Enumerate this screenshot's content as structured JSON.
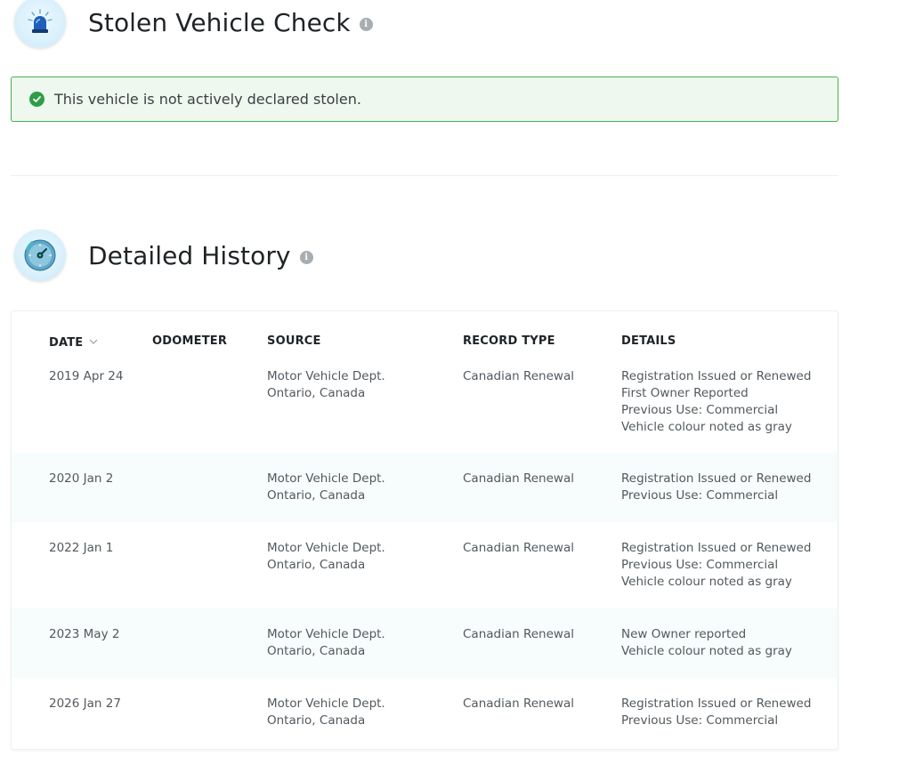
{
  "stolen": {
    "title": "Stolen Vehicle Check",
    "icon": "siren-icon",
    "status_text": "This vehicle is not actively declared stolen.",
    "status_color": "#2e9e46"
  },
  "history": {
    "title": "Detailed History",
    "icon": "odometer-gauge-icon",
    "columns": {
      "date": "DATE",
      "odometer": "ODOMETER",
      "source": "SOURCE",
      "record_type": "RECORD TYPE",
      "details": "DETAILS"
    },
    "rows": [
      {
        "date": "2019 Apr 24",
        "odometer": "",
        "source": [
          "Motor Vehicle Dept.",
          "Ontario, Canada"
        ],
        "record_type": "Canadian Renewal",
        "details": [
          "Registration Issued or Renewed",
          "First Owner Reported",
          "Previous Use: Commercial",
          "Vehicle colour noted as gray"
        ]
      },
      {
        "date": "2020 Jan 2",
        "odometer": "",
        "source": [
          "Motor Vehicle Dept.",
          "Ontario, Canada"
        ],
        "record_type": "Canadian Renewal",
        "details": [
          "Registration Issued or Renewed",
          "Previous Use: Commercial"
        ]
      },
      {
        "date": "2022 Jan 1",
        "odometer": "",
        "source": [
          "Motor Vehicle Dept.",
          "Ontario, Canada"
        ],
        "record_type": "Canadian Renewal",
        "details": [
          "Registration Issued or Renewed",
          "Previous Use: Commercial",
          "Vehicle colour noted as gray"
        ]
      },
      {
        "date": "2023 May 2",
        "odometer": "",
        "source": [
          "Motor Vehicle Dept.",
          "Ontario, Canada"
        ],
        "record_type": "Canadian Renewal",
        "details": [
          "New Owner reported",
          "Vehicle colour noted as gray"
        ]
      },
      {
        "date": "2026 Jan 27",
        "odometer": "",
        "source": [
          "Motor Vehicle Dept.",
          "Ontario, Canada"
        ],
        "record_type": "Canadian Renewal",
        "details": [
          "Registration Issued or Renewed",
          "Previous Use: Commercial"
        ]
      }
    ]
  }
}
